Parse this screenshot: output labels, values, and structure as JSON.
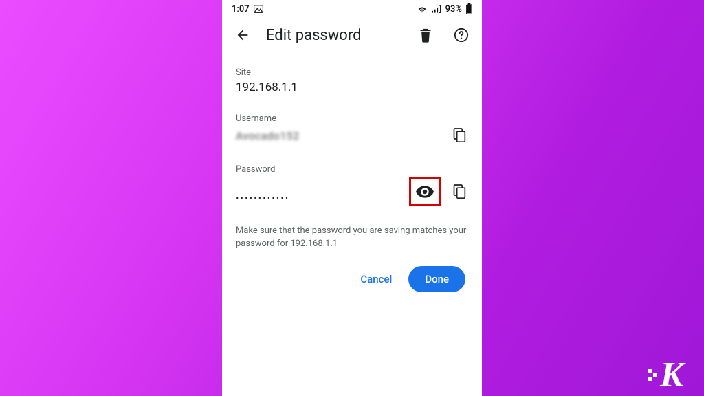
{
  "status": {
    "time": "1:07",
    "battery_text": "93%"
  },
  "appbar": {
    "title": "Edit password"
  },
  "site": {
    "label": "Site",
    "value": "192.168.1.1"
  },
  "username": {
    "label": "Username",
    "value": "Avocado152"
  },
  "password": {
    "label": "Password",
    "mask": "············"
  },
  "hint": "Make sure that the password you are saving matches your password for 192.168.1.1",
  "actions": {
    "cancel": "Cancel",
    "done": "Done"
  }
}
